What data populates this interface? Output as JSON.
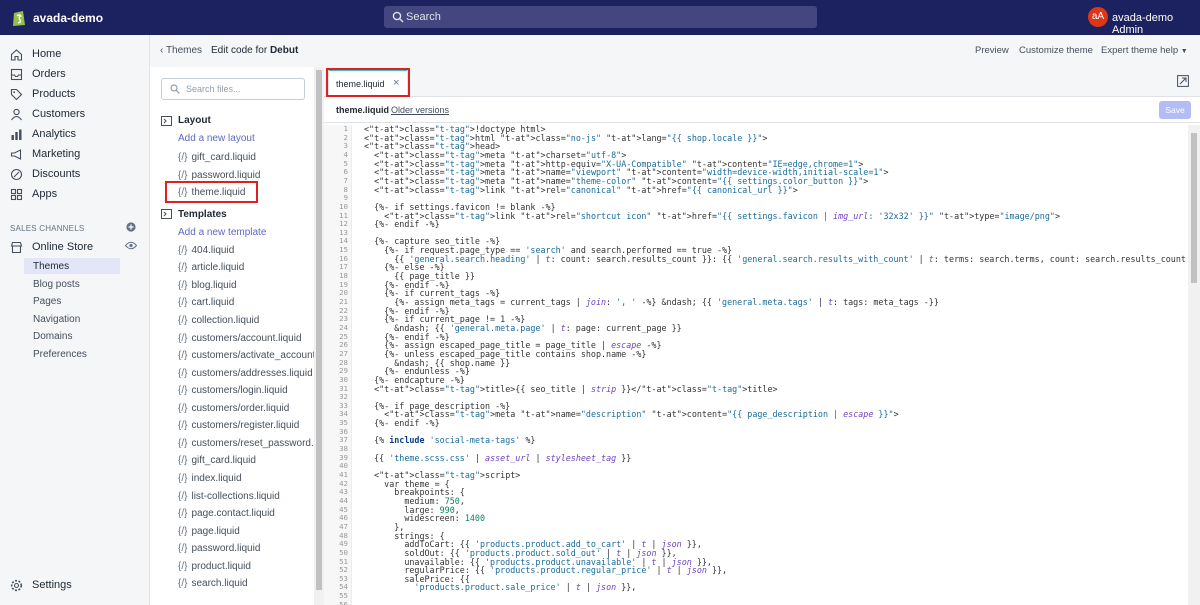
{
  "topbar": {
    "store_name": "avada-demo",
    "search_placeholder": "Search",
    "avatar_initials": "aA",
    "admin_name": "avada-demo Admin"
  },
  "nav": {
    "home": "Home",
    "orders": "Orders",
    "products": "Products",
    "customers": "Customers",
    "analytics": "Analytics",
    "marketing": "Marketing",
    "discounts": "Discounts",
    "apps": "Apps",
    "sales_channels": "SALES CHANNELS",
    "online_store": "Online Store",
    "sub": [
      "Themes",
      "Blog posts",
      "Pages",
      "Navigation",
      "Domains",
      "Preferences"
    ],
    "settings": "Settings"
  },
  "header": {
    "back": "Themes",
    "edit_prefix": "Edit code for",
    "theme_name": "Debut",
    "preview": "Preview",
    "customize": "Customize theme",
    "help": "Expert theme help"
  },
  "files": {
    "search_placeholder": "Search files...",
    "layout": "Layout",
    "add_layout": "Add a new layout",
    "layout_files": [
      "gift_card.liquid",
      "password.liquid",
      "theme.liquid"
    ],
    "templates": "Templates",
    "add_template": "Add a new template",
    "template_files": [
      "404.liquid",
      "article.liquid",
      "blog.liquid",
      "cart.liquid",
      "collection.liquid",
      "customers/account.liquid",
      "customers/activate_account.lic",
      "customers/addresses.liquid",
      "customers/login.liquid",
      "customers/order.liquid",
      "customers/register.liquid",
      "customers/reset_password.liqu",
      "gift_card.liquid",
      "index.liquid",
      "list-collections.liquid",
      "page.contact.liquid",
      "page.liquid",
      "password.liquid",
      "product.liquid",
      "search.liquid"
    ],
    "bracket": "{/}"
  },
  "editor": {
    "tab_label": "theme.liquid",
    "tab_close": "×",
    "file_name": "theme.liquid",
    "older_versions": "Older versions",
    "save": "Save"
  },
  "code_lines": [
    "<!doctype html>",
    "<html class=\"no-js\" lang=\"{{ shop.locale }}\">",
    "<head>",
    "  <meta charset=\"utf-8\">",
    "  <meta http-equiv=\"X-UA-Compatible\" content=\"IE=edge,chrome=1\">",
    "  <meta name=\"viewport\" content=\"width=device-width,initial-scale=1\">",
    "  <meta name=\"theme-color\" content=\"{{ settings.color_button }}\">",
    "  <link rel=\"canonical\" href=\"{{ canonical_url }}\">",
    "",
    "  {%- if settings.favicon != blank -%}",
    "    <link rel=\"shortcut icon\" href=\"{{ settings.favicon | img_url: '32x32' }}\" type=\"image/png\">",
    "  {%- endif -%}",
    "",
    "  {%- capture seo_title -%}",
    "    {%- if request.page_type == 'search' and search.performed == true -%}",
    "      {{ 'general.search.heading' | t: count: search.results_count }}: {{ 'general.search.results_with_count' | t: terms: search.terms, count: search.results_count }}",
    "    {%- else -%}",
    "      {{ page_title }}",
    "    {%- endif -%}",
    "    {%- if current_tags -%}",
    "      {%- assign meta_tags = current_tags | join: ', ' -%} &ndash; {{ 'general.meta.tags' | t: tags: meta_tags -}}",
    "    {%- endif -%}",
    "    {%- if current_page != 1 -%}",
    "      &ndash; {{ 'general.meta.page' | t: page: current_page }}",
    "    {%- endif -%}",
    "    {%- assign escaped_page_title = page_title | escape -%}",
    "    {%- unless escaped_page_title contains shop.name -%}",
    "      &ndash; {{ shop.name }}",
    "    {%- endunless -%}",
    "  {%- endcapture -%}",
    "  <title>{{ seo_title | strip }}</title>",
    "",
    "  {%- if page_description -%}",
    "    <meta name=\"description\" content=\"{{ page_description | escape }}\">",
    "  {%- endif -%}",
    "",
    "  {% include 'social-meta-tags' %}",
    "",
    "  {{ 'theme.scss.css' | asset_url | stylesheet_tag }}",
    "",
    "  <script>",
    "    var theme = {",
    "      breakpoints: {",
    "        medium: 750,",
    "        large: 990,",
    "        widescreen: 1400",
    "      },",
    "      strings: {",
    "        addToCart: {{ 'products.product.add_to_cart' | t | json }},",
    "        soldOut: {{ 'products.product.sold_out' | t | json }},",
    "        unavailable: {{ 'products.product.unavailable' | t | json }},",
    "        regularPrice: {{ 'products.product.regular_price' | t | json }},",
    "        salePrice: {{",
    "          'products.product.sale_price' | t | json }},",
    "",
    ""
  ]
}
